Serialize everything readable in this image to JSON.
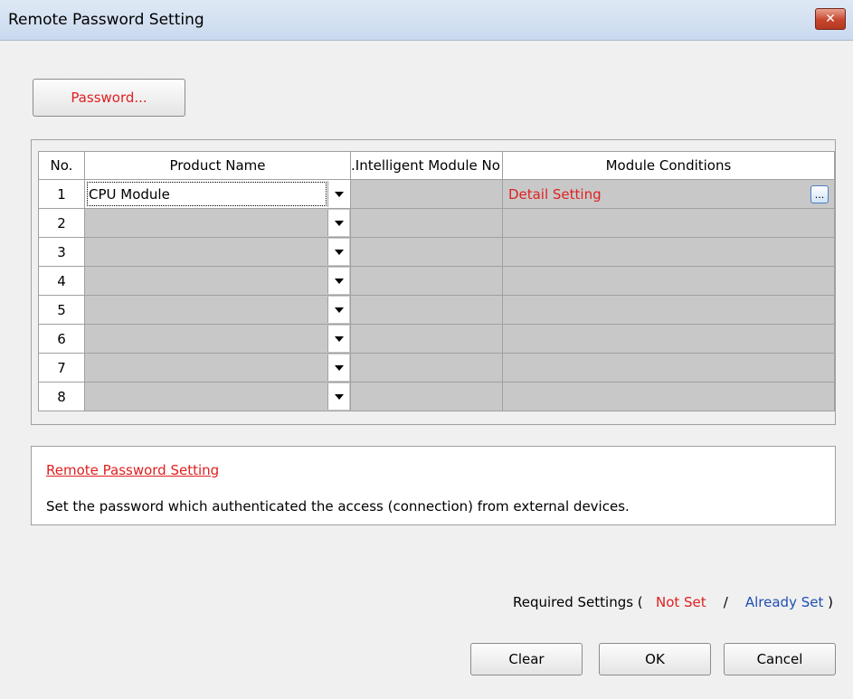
{
  "window": {
    "title": "Remote Password Setting",
    "close_label": "✕"
  },
  "password_button": "Password...",
  "table": {
    "headers": [
      "No.",
      "Product Name",
      "Intelligent Module No.",
      "Module Conditions"
    ],
    "rows": [
      {
        "no": "1",
        "product": "CPU Module",
        "condition": "Detail Setting"
      },
      {
        "no": "2",
        "product": "",
        "condition": ""
      },
      {
        "no": "3",
        "product": "",
        "condition": ""
      },
      {
        "no": "4",
        "product": "",
        "condition": ""
      },
      {
        "no": "5",
        "product": "",
        "condition": ""
      },
      {
        "no": "6",
        "product": "",
        "condition": ""
      },
      {
        "no": "7",
        "product": "",
        "condition": ""
      },
      {
        "no": "8",
        "product": "",
        "condition": ""
      }
    ],
    "ellipsis_label": "..."
  },
  "description": {
    "title": "Remote Password Setting",
    "text": "Set the password which authenticated the access (connection) from external devices."
  },
  "required": {
    "prefix": "Required Settings (",
    "not_set": "Not Set",
    "separator": "/",
    "already_set": "Already Set",
    "suffix": ")"
  },
  "buttons": {
    "clear": "Clear",
    "ok": "OK",
    "cancel": "Cancel"
  },
  "colors": {
    "required_red": "#e02020",
    "already_set_blue": "#1f4fb3"
  }
}
